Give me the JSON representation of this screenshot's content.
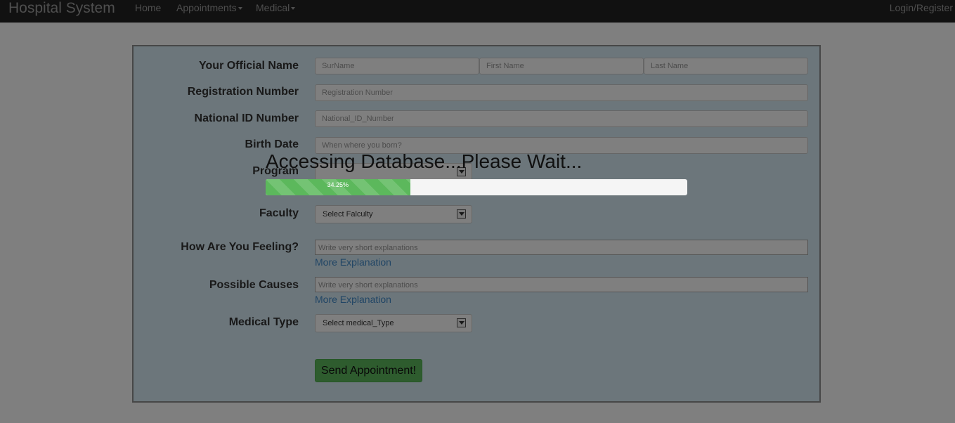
{
  "navbar": {
    "brand": "Hospital System",
    "home": "Home",
    "appointments": "Appointments",
    "medical": "Medical",
    "login": "Login/Register"
  },
  "form": {
    "official_name_label": "Your Official Name",
    "surname_placeholder": "SurName",
    "first_name_placeholder": "First Name",
    "last_name_placeholder": "Last Name",
    "registration_label": "Registration Number",
    "registration_placeholder": "Registration Number",
    "national_id_label": "National ID Number",
    "national_id_placeholder": "National_ID_Number",
    "birth_date_label": "Birth Date",
    "birth_date_placeholder": "When where you born?",
    "program_label": "Program",
    "faculty_label": "Faculty",
    "faculty_selected": "Select Falculty",
    "feeling_label": "How Are You Feeling?",
    "feeling_placeholder": "Write very short explanations",
    "feeling_more": "More Explanation",
    "causes_label": "Possible Causes",
    "causes_placeholder": "Write very short explanations",
    "causes_more": "More Explanation",
    "medical_type_label": "Medical Type",
    "medical_type_selected": "Select medical_Type",
    "send_button": "Send Appointment!"
  },
  "loading": {
    "message": "Accessing Database...Please Wait...",
    "progress_label": "34.25%",
    "progress_fraction": 0.3425
  },
  "colors": {
    "navbar": "#222222",
    "panel": "#d9edf7",
    "progress": "#5cb85c",
    "link": "#428bca"
  }
}
